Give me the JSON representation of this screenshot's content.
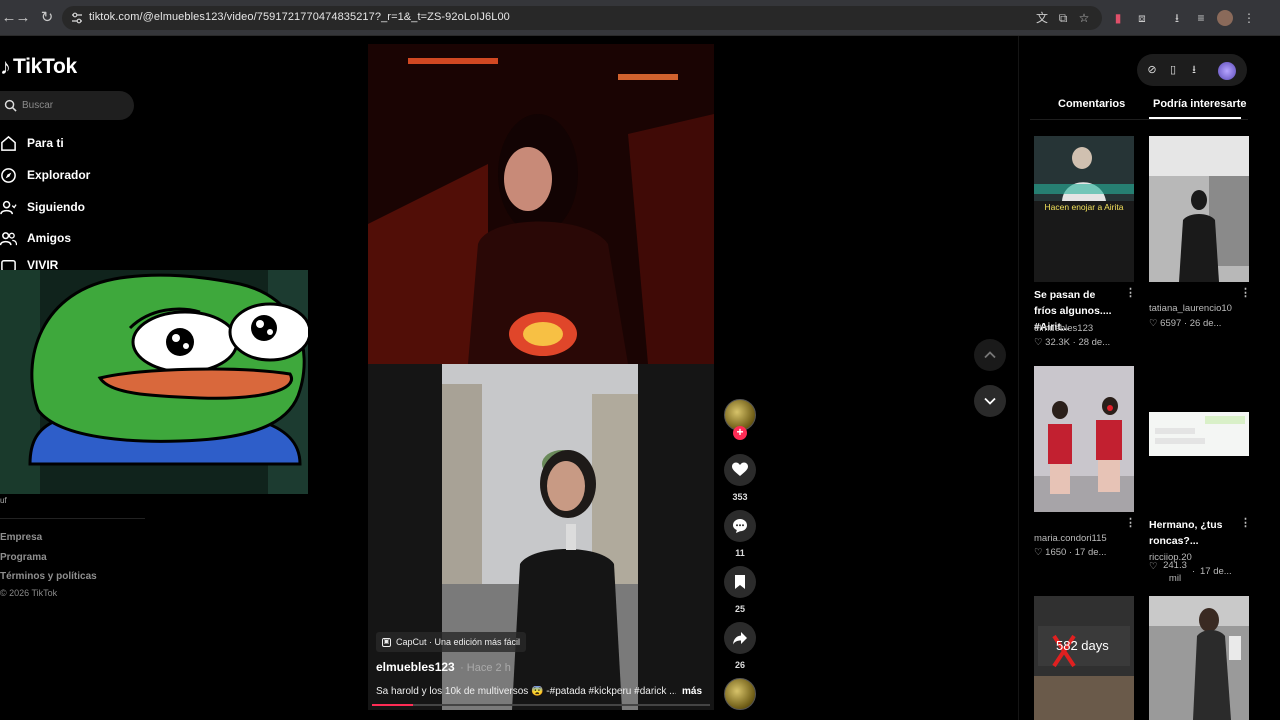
{
  "browser": {
    "url": "tiktok.com/@elmuebles123/video/7591721770474835217?_r=1&_t=ZS-92oLoIJ6L00"
  },
  "sidebar": {
    "logo": "TikTok",
    "search_placeholder": "Buscar",
    "nav": [
      {
        "label": "Para ti",
        "icon": "home-icon"
      },
      {
        "label": "Explorador",
        "icon": "compass-icon"
      },
      {
        "label": "Siguiendo",
        "icon": "following-icon"
      },
      {
        "label": "Amigos",
        "icon": "friends-icon"
      },
      {
        "label": "VIVIR",
        "icon": "live-icon"
      }
    ],
    "footer": [
      "Empresa",
      "Programa",
      "Términos y políticas"
    ],
    "copyright": "© 2026 TikTok",
    "cut_text": "uf"
  },
  "video": {
    "capcut_label": "CapCut · Una edición más fácil",
    "author": "elmuebles123",
    "time": "· Hace 2 h",
    "caption": "Sa harold y los 10k de multiversos 😨 -#patada #kickperu #darick ...",
    "more": "más",
    "progress": 0.12,
    "likes": "353",
    "comments": "11",
    "saves": "25",
    "shares": "26"
  },
  "right_panel": {
    "tabs": [
      "Comentarios",
      "Podría interesarte"
    ],
    "active_tab": "Podría interesarte",
    "items": [
      {
        "title": "Se pasan de fríos algunos.... #Airit...",
        "user": "elmuebles123",
        "likes": "32.3K",
        "date": "28 de...",
        "overlay": "Hacen enojar a Airita"
      },
      {
        "title": "",
        "user": "tatiana_laurencio10",
        "likes": "6597",
        "date": "26 de..."
      },
      {
        "title": "",
        "user": "maria.condori115",
        "likes": "1650",
        "date": "17 de..."
      },
      {
        "title": "Hermano, ¿tus roncas?...",
        "user": "ricciiop.20",
        "likes": "241.3 mil",
        "date": "17 de..."
      },
      {
        "overlay": "582 days"
      },
      {
        "overlay": ""
      }
    ]
  }
}
